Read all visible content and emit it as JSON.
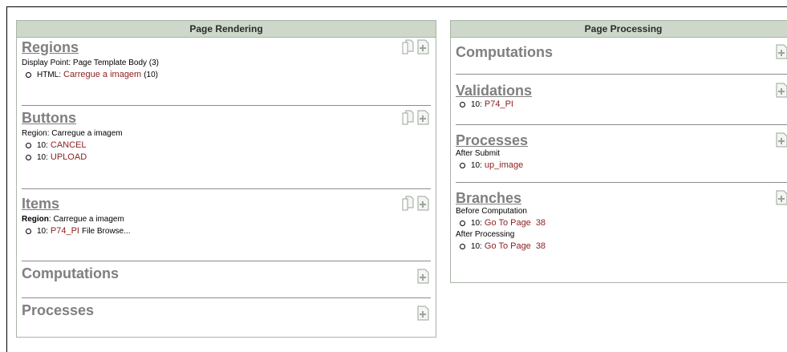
{
  "rendering": {
    "header": "Page Rendering",
    "regions": {
      "title": "Regions",
      "subtitle": "Display Point: Page Template Body (3)",
      "items": [
        {
          "prefix": "HTML:",
          "link": "Carregue a imagem",
          "suffix": "(10)"
        }
      ]
    },
    "buttons": {
      "title": "Buttons",
      "subtitle": "Region: Carregue a imagem",
      "items": [
        {
          "prefix": "10:",
          "link": "CANCEL"
        },
        {
          "prefix": "10:",
          "link": "UPLOAD"
        }
      ]
    },
    "items": {
      "title": "Items",
      "subtitle_label": "Region",
      "subtitle_rest": ": Carregue a imagem",
      "items": [
        {
          "prefix": "10:",
          "link": "P74_PI",
          "suffix": "File Browse..."
        }
      ]
    },
    "computations": {
      "title": "Computations"
    },
    "processes": {
      "title": "Processes"
    }
  },
  "processing": {
    "header": "Page Processing",
    "computations": {
      "title": "Computations"
    },
    "validations": {
      "title": "Validations",
      "items": [
        {
          "prefix": "10:",
          "link": "P74_PI"
        }
      ]
    },
    "processes": {
      "title": "Processes",
      "subtitle": "After Submit",
      "items": [
        {
          "prefix": "10:",
          "link": "up_image"
        }
      ]
    },
    "branches": {
      "title": "Branches",
      "groups": [
        {
          "subtitle": "Before Computation",
          "prefix": "10:",
          "link": "Go To Page",
          "target": "38"
        },
        {
          "subtitle": "After Processing",
          "prefix": "10:",
          "link": "Go To Page",
          "target": "38"
        }
      ]
    }
  }
}
